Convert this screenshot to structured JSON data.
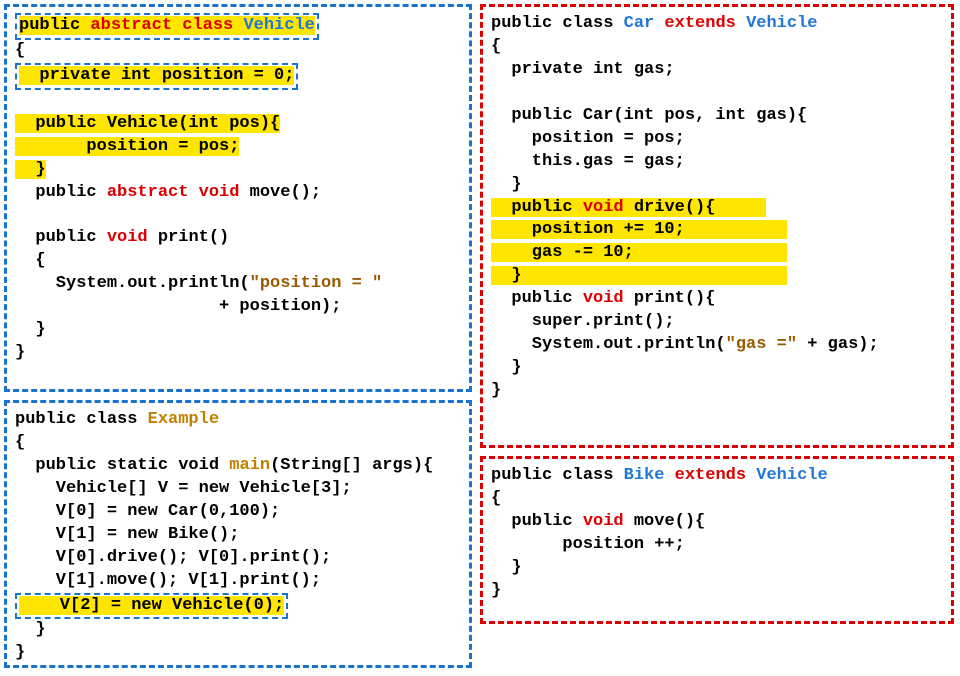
{
  "vehicle": {
    "l1a": "public ",
    "l1b": "abstract class",
    "l1c": " ",
    "l1d": "Vehicle",
    "l2": "{",
    "l3": "  private int position = 0;",
    "l4": "",
    "l5": "  public Vehicle(int pos){",
    "l6": "       position = pos;",
    "l7": "  }",
    "l8a": "  public ",
    "l8b": "abstract void",
    "l8c": " move();",
    "l9": "",
    "l10a": "  public ",
    "l10b": "void",
    "l10c": " print()",
    "l11": "  {",
    "l12a": "    System.out.println(",
    "l12b": "\"position = \"",
    "l13": "                    + position);",
    "l14": "  }",
    "l15": "}"
  },
  "example": {
    "l1a": "public class ",
    "l1b": "Example",
    "l2": "{",
    "l3a": "  public static void ",
    "l3b": "main",
    "l3c": "(String[] args){",
    "l4": "    Vehicle[] V = new Vehicle[3];",
    "l5": "    V[0] = new Car(0,100);",
    "l6": "    V[1] = new Bike();",
    "l7": "    V[0].drive(); V[0].print();",
    "l8": "    V[1].move(); V[1].print();",
    "l9": "    V[2] = new Vehicle(0);",
    "l10": "  }",
    "l11": "}"
  },
  "car": {
    "l1a": "public class ",
    "l1b": "Car",
    "l1c": " extends ",
    "l1d": "Vehicle",
    "l2": "{",
    "l3": "  private int gas;",
    "l4": "",
    "l5": "  public Car(int pos, int gas){",
    "l6": "    position = pos;",
    "l7": "    this.gas = gas;",
    "l8": "  }",
    "l9a": "  public ",
    "l9b": "void",
    "l9c": " drive(){",
    "l10": "    position += 10;",
    "l11": "    gas -= 10;",
    "l12": "  }",
    "l13a": "  public ",
    "l13b": "void",
    "l13c": " print(){",
    "l14": "    super.print();",
    "l15a": "    System.out.println(",
    "l15b": "\"gas =\"",
    "l15c": " + gas);",
    "l16": "  }",
    "l17": "}"
  },
  "bike": {
    "l1a": "public class ",
    "l1b": "Bike",
    "l1c": " extends ",
    "l1d": "Vehicle",
    "l2": "{",
    "l3a": "  public ",
    "l3b": "void",
    "l3c": " move(){",
    "l4": "       position ++;",
    "l5": "  }",
    "l6": "}"
  }
}
